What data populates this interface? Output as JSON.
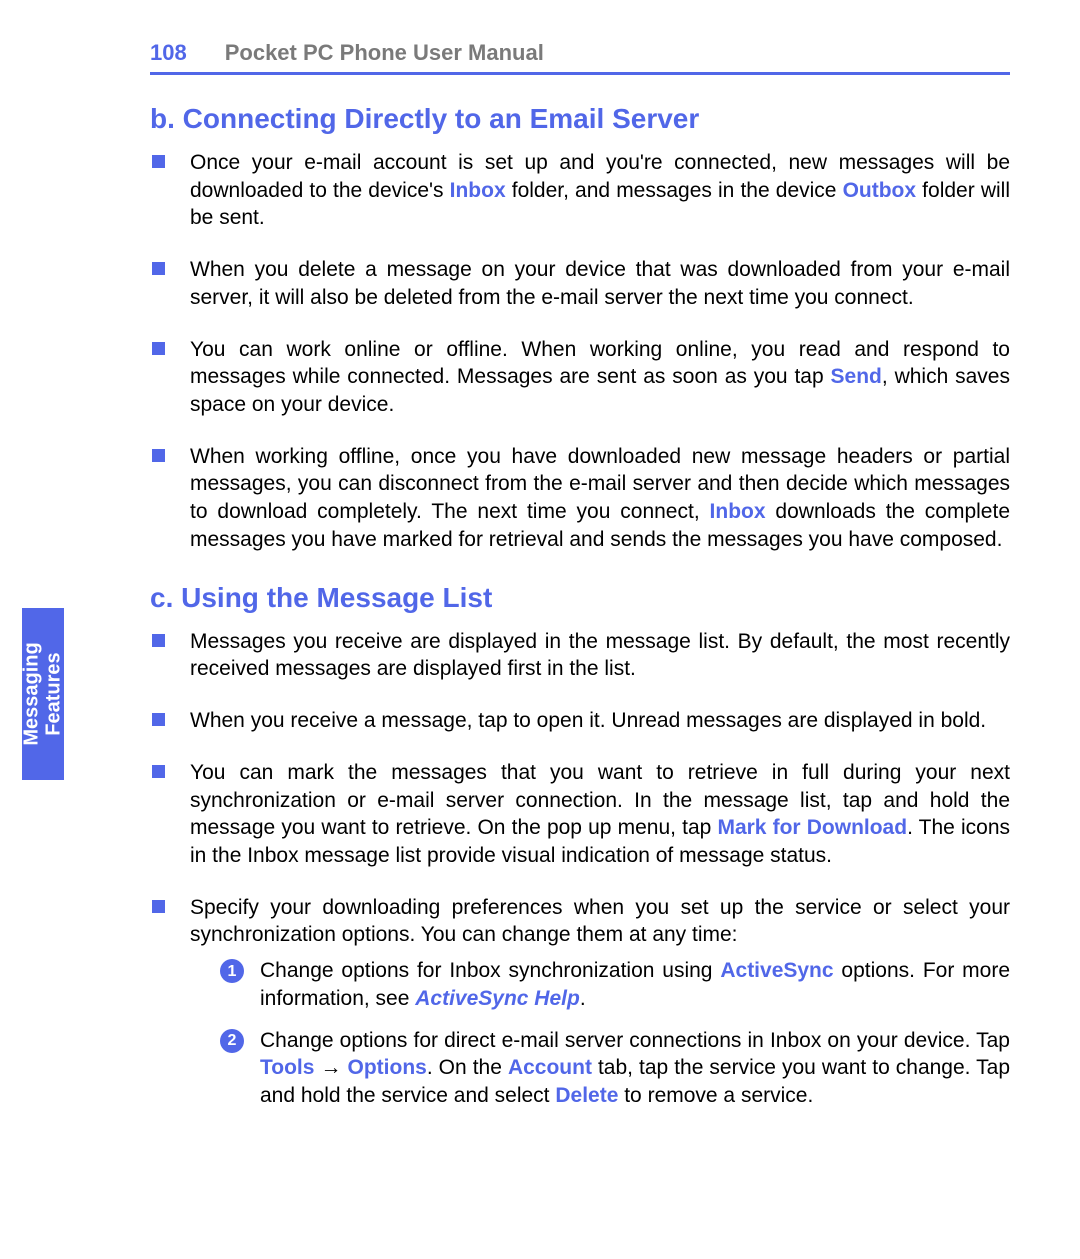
{
  "header": {
    "page_number": "108",
    "title": "Pocket PC Phone User Manual"
  },
  "side_tab": {
    "line1": "Messaging",
    "line2": "Features"
  },
  "section_b": {
    "heading": "b. Connecting Directly to an Email Server",
    "items": [
      {
        "pre": "Once your e-mail account is set up and you're connected, new messages will be downloaded to the device's ",
        "k1": "Inbox",
        "mid": " folder, and messages in the device ",
        "k2": "Outbox",
        "post": " folder will be sent."
      },
      {
        "text": "When you delete a message on your device that was downloaded from your e-mail server, it will also be deleted from the e-mail server the next time you connect."
      },
      {
        "pre": "You can work online or offline. When working online, you read and respond to messages while connected. Messages are sent as soon as you tap ",
        "k1": "Send",
        "post": ", which saves space on your device."
      },
      {
        "pre": "When working offline, once you have downloaded new message headers or partial messages, you can disconnect from the e-mail server and then decide which messages to download completely. The next time you connect, ",
        "k1": "Inbox",
        "post": " downloads the complete messages you have marked for retrieval and sends the messages you have composed."
      }
    ]
  },
  "section_c": {
    "heading": "c. Using the Message List",
    "items": [
      {
        "text": "Messages you receive are displayed in the message list. By default, the most recently received messages are displayed first in the list."
      },
      {
        "text": "When you receive a message, tap to open it. Unread messages are displayed in bold."
      },
      {
        "pre": "You can mark the messages that you want to retrieve in full during your next synchronization or e-mail server connection. In the message list, tap and hold the message you want to retrieve. On the pop up menu, tap ",
        "k1": "Mark for Download",
        "post": ". The icons in the Inbox message list provide  visual indication of message status."
      },
      {
        "text": "Specify your downloading preferences when you set up the service or select your synchronization options. You can change them at any time:",
        "sub": [
          {
            "num": "1",
            "pre": "Change options for Inbox synchronization using ",
            "k1": "ActiveSync",
            "mid": " options. For more information, see ",
            "k2": "ActiveSync Help",
            "post": "."
          },
          {
            "num": "2",
            "pre": "Change options for direct e-mail server connections in Inbox on your device. Tap ",
            "k1": "Tools",
            "mid1": "  →  ",
            "k2": "Options",
            "mid2": ". On the ",
            "k3": "Account",
            "mid3": "  tab, tap the service you want to change. Tap and hold the service and select ",
            "k4": "Delete",
            "post": " to remove a service."
          }
        ]
      }
    ]
  }
}
